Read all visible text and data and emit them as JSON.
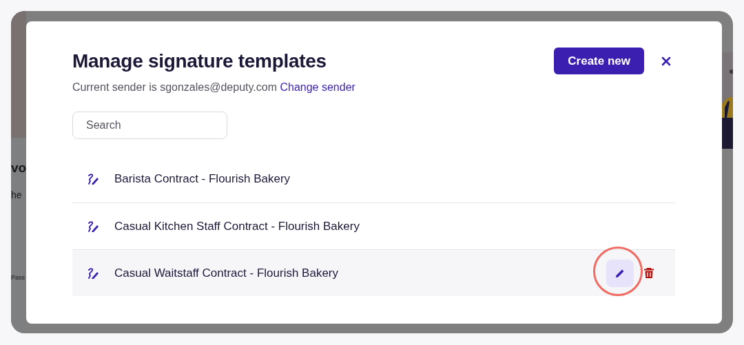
{
  "background": {
    "texts": [
      {
        "kind": "heading",
        "text": "vo"
      },
      {
        "kind": "body",
        "text": "he"
      },
      {
        "kind": "small",
        "text": "Pass"
      }
    ]
  },
  "dialog": {
    "title": "Manage signature templates",
    "create_button": "Create new",
    "sender_text": "Current sender is sgonzales@deputy.com",
    "change_sender_link": "Change sender",
    "search": {
      "placeholder": "Search"
    },
    "templates": [
      {
        "name": "Barista Contract - Flourish Bakery",
        "selected": false
      },
      {
        "name": "Casual Kitchen Staff Contract - Flourish Bakery",
        "selected": false
      },
      {
        "name": "Casual Waitstaff Contract - Flourish Bakery",
        "selected": true
      }
    ]
  }
}
